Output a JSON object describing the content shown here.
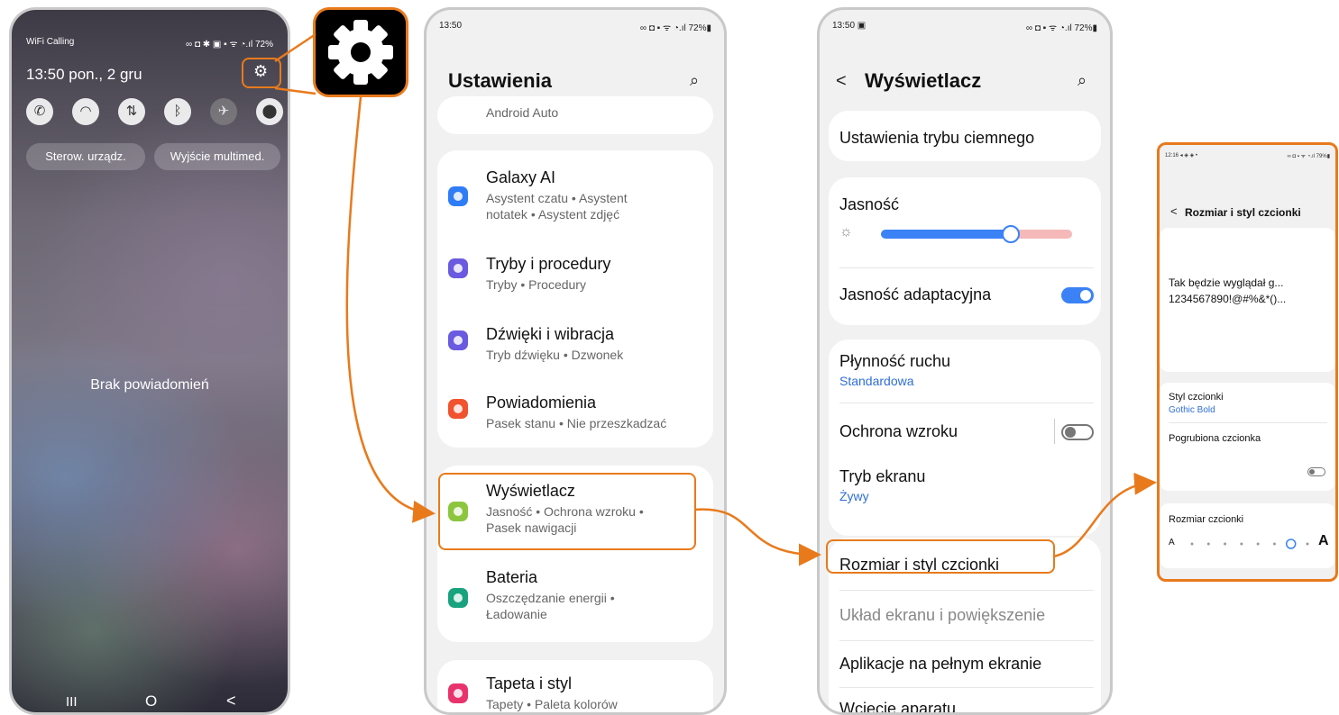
{
  "panel1": {
    "status_left": "WiFi Calling",
    "status_right": "∞ ◘ ✱ ▣ ▪ ᯤ ◔.ıl 72%",
    "datetime": "13:50 pon., 2 gru",
    "pill_left": "Sterow. urządz.",
    "pill_right": "Wyjście multimed.",
    "empty_text": "Brak powiadomień",
    "nav_recent": "III",
    "nav_home": "O",
    "nav_back": "<"
  },
  "gear_callout": {
    "icon": "gear-icon"
  },
  "panel2": {
    "time": "13:50",
    "status_right": "∞ ◘ ▪ ᯤ ◔.ıl 72%▮",
    "title": "Ustawienia",
    "android_auto": "Android Auto",
    "items": [
      {
        "title": "Galaxy AI",
        "sub1": "Asystent czatu • Asystent",
        "sub2": "notatek • Asystent zdjęć",
        "color": "#2f7df6"
      },
      {
        "title": "Tryby i procedury",
        "sub1": "Tryby • Procedury",
        "sub2": "",
        "color": "#6a5ae0"
      },
      {
        "title": "Dźwięki i wibracja",
        "sub1": "Tryb dźwięku • Dzwonek",
        "sub2": "",
        "color": "#6a5ae0"
      },
      {
        "title": "Powiadomienia",
        "sub1": "Pasek stanu • Nie przeszkadzać",
        "sub2": "",
        "color": "#f0532e"
      },
      {
        "title": "Wyświetlacz",
        "sub1": "Jasność • Ochrona wzroku •",
        "sub2": "Pasek nawigacji",
        "color": "#8cc63f"
      },
      {
        "title": "Bateria",
        "sub1": "Oszczędzanie energii •",
        "sub2": "Ładowanie",
        "color": "#18a37e"
      },
      {
        "title": "Tapeta i styl",
        "sub1": "Tapety • Paleta kolorów",
        "sub2": "",
        "color": "#e8336d"
      }
    ]
  },
  "panel3": {
    "time": "13:50 ▣",
    "status_right": "∞ ◘ ▪ ᯤ ◔.ıl 72%▮",
    "back": "<",
    "title": "Wyświetlacz",
    "dark_mode": "Ustawienia trybu ciemnego",
    "brightness": "Jasność",
    "brightness_level": 0.68,
    "adaptive": "Jasność adaptacyjna",
    "adaptive_on": true,
    "motion": "Płynność ruchu",
    "motion_value": "Standardowa",
    "eye": "Ochrona wzroku",
    "eye_on": false,
    "screen_mode": "Tryb ekranu",
    "screen_mode_value": "Żywy",
    "font": "Rozmiar i styl czcionki",
    "layout": "Układ ekranu i powiększenie",
    "fullscreen": "Aplikacje na pełnym ekranie",
    "cutout": "Wcięcie aparatu"
  },
  "panel4": {
    "time": "12:16 ◂ ◈ ◈ •",
    "status_right": "∞ ◘ ▪ ᯤ ◔.ıl 79%▮",
    "back": "<",
    "title": "Rozmiar i styl czcionki",
    "preview1": "Tak będzie wyglądał g...",
    "preview2": "1234567890!@#%&*()...",
    "style_label": "Styl czcionki",
    "style_value": "Gothic Bold",
    "bold_label": "Pogrubiona czcionka",
    "size_label": "Rozmiar czcionki",
    "small_a": "A",
    "big_a": "A",
    "size_level": 6,
    "size_steps": 8
  },
  "colors": {
    "accent": "#e87a1c",
    "blue": "#3b82f6",
    "link": "#2f6fd6"
  }
}
